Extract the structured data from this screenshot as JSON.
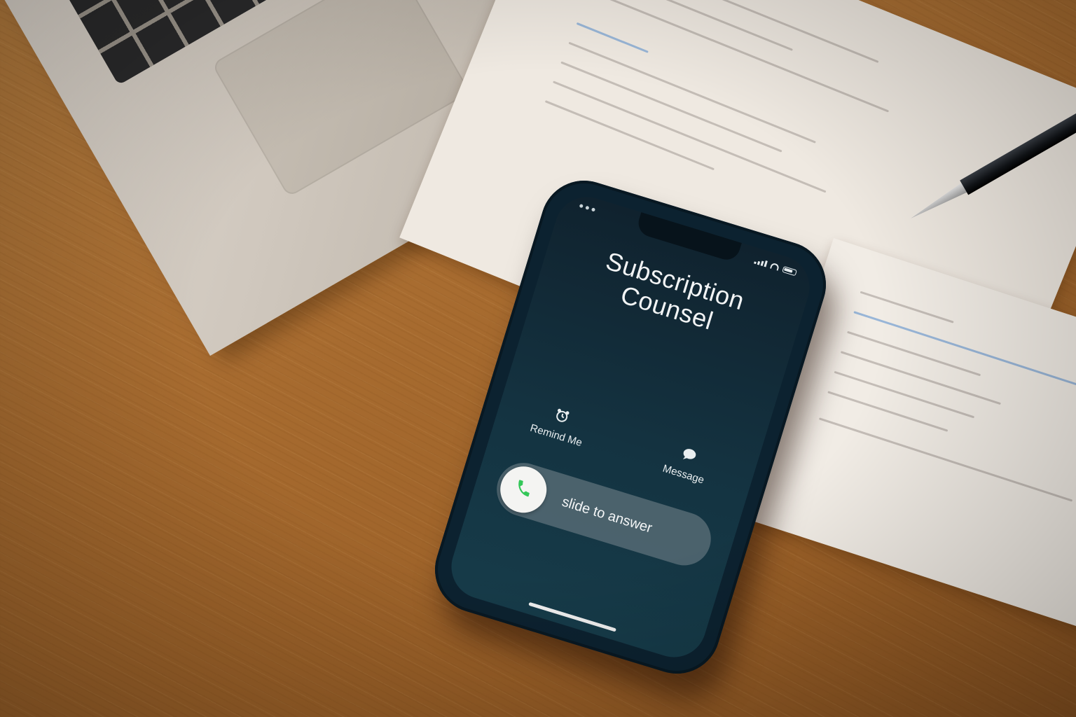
{
  "call": {
    "caller_line1": "Subscription",
    "caller_line2": "Counsel",
    "remind_label": "Remind Me",
    "message_label": "Message",
    "slide_label": "slide to answer",
    "icons": {
      "remind": "alarm-clock-icon",
      "message": "speech-bubble-icon",
      "answer": "phone-icon"
    },
    "accent_color": "#34c759"
  }
}
